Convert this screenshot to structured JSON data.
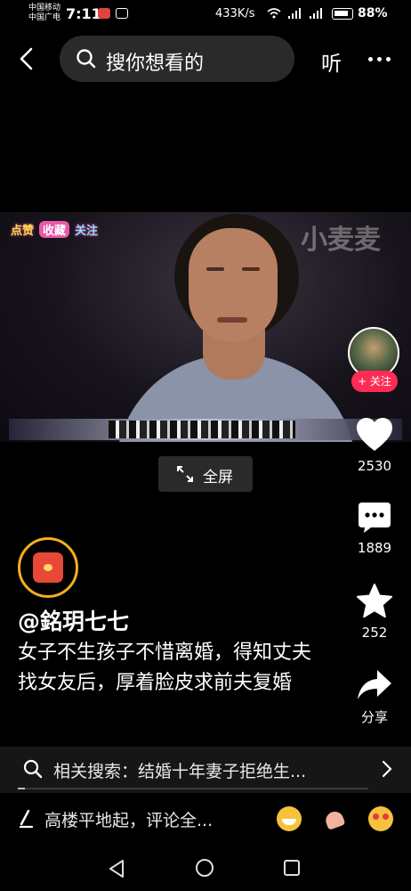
{
  "status_bar": {
    "carrier_1": "中国移动",
    "carrier_2": "中国广电",
    "time": "7:11",
    "net_speed": "433K/s",
    "battery": "88%"
  },
  "top_nav": {
    "search_placeholder": "搜你想看的",
    "listen_label": "听"
  },
  "video": {
    "badge": [
      "点赞",
      "收藏",
      "关注"
    ],
    "watermark": "小麦麦"
  },
  "author": {
    "follow_label": "+ 关注",
    "name": "@銘玥七七",
    "caption": "女子不生孩子不惜离婚，得知丈夫找女友后，厚着脸皮求前夫复婚"
  },
  "actions": {
    "like_count": "2530",
    "comment_count": "1889",
    "favorite_count": "252",
    "share_label": "分享"
  },
  "fullscreen_label": "全屏",
  "related_search": {
    "text": "相关搜索：结婚十年妻子拒绝生..."
  },
  "playback_progress_fraction": 0.02,
  "comment_bar": {
    "placeholder": "高楼平地起，评论全..."
  },
  "colors": {
    "accent_red": "#fe2c55",
    "background": "#000000",
    "badge_ring": "#f0b020"
  }
}
